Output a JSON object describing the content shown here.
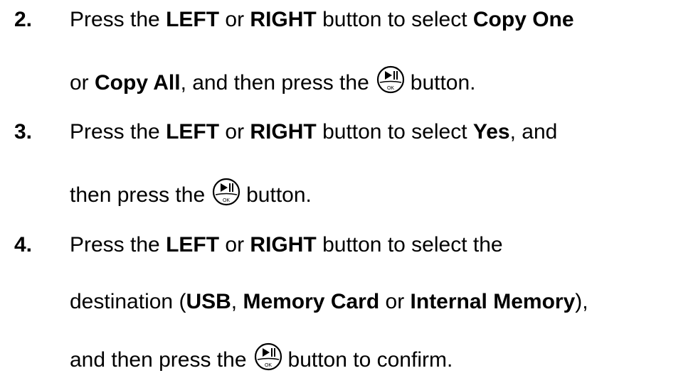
{
  "steps": [
    {
      "number": "2.",
      "line1": {
        "t1": "Press the ",
        "b1": "LEFT",
        "t2": " or ",
        "b2": "RIGHT",
        "t3": " button to select ",
        "b3": "Copy One"
      },
      "line2": {
        "t1": "or ",
        "b1": "Copy All",
        "t2": ", and then press the",
        "t3": "button."
      }
    },
    {
      "number": "3.",
      "line1": {
        "t1": "Press the ",
        "b1": "LEFT",
        "t2": " or ",
        "b2": "RIGHT",
        "t3": " button to select ",
        "b3": "Yes",
        "t4": ", and"
      },
      "line2": {
        "t1": "then press the",
        "t2": "button."
      }
    },
    {
      "number": "4.",
      "line1": {
        "t1": "Press the ",
        "b1": "LEFT",
        "t2": " or ",
        "b2": "RIGHT",
        "t3": " button to select the"
      },
      "line2": {
        "t1": "destination (",
        "b1": "USB",
        "t2": ", ",
        "b2": "Memory Card",
        "t3": " or ",
        "b3": "Internal Memory",
        "t4": "),"
      },
      "line3": {
        "t1": "and then press the",
        "t2": "button to confirm."
      }
    }
  ],
  "icon": {
    "name": "play-pause-ok-icon",
    "glyph_top": "►II",
    "glyph_bottom": "OK"
  }
}
